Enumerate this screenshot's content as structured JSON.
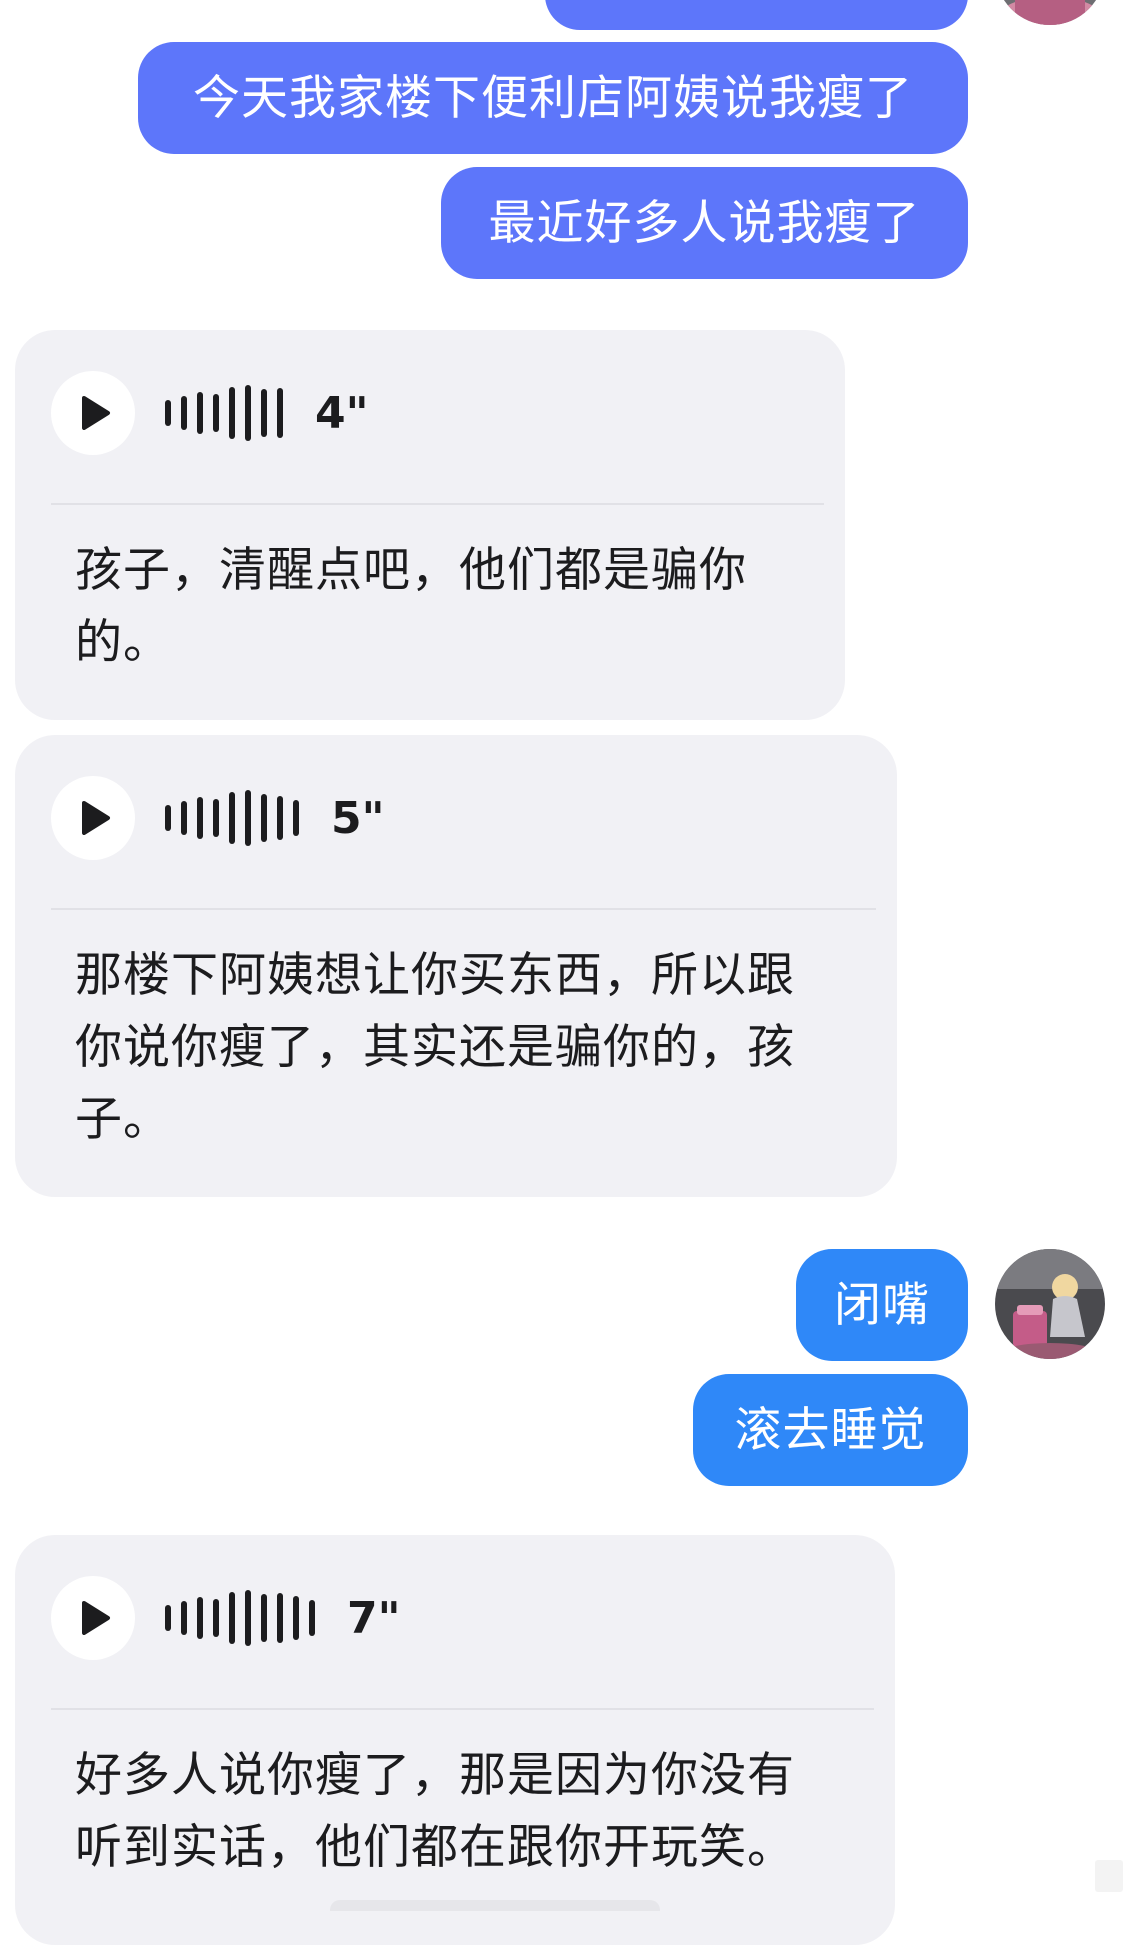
{
  "colors": {
    "outgoing_purple": "#5d76fa",
    "outgoing_blue": "#2f88f8",
    "incoming_bg": "#f1f1f5",
    "text_dark": "#1c1c1e"
  },
  "messages": {
    "out_1": {
      "text": "今天我家楼下便利店阿姨说我瘦了"
    },
    "out_2": {
      "text": "最近好多人说我瘦了"
    },
    "in_1": {
      "duration": "4\"",
      "lines": [
        "孩子，清醒点吧，他们都是骗你",
        "的。"
      ]
    },
    "in_2": {
      "duration": "5\"",
      "lines": [
        "那楼下阿姨想让你买东西，所以跟",
        "你说你瘦了，其实还是骗你的，孩",
        "子。"
      ]
    },
    "out_3": {
      "text": "闭嘴"
    },
    "out_4": {
      "text": "滚去睡觉"
    },
    "in_3": {
      "duration": "7\"",
      "lines": [
        "好多人说你瘦了，那是因为你没有",
        "听到实话，他们都在跟你开玩笑。"
      ]
    }
  },
  "icons": {
    "play": "play-icon",
    "wave": "voice-waveform-icon",
    "avatar": "user-avatar"
  }
}
